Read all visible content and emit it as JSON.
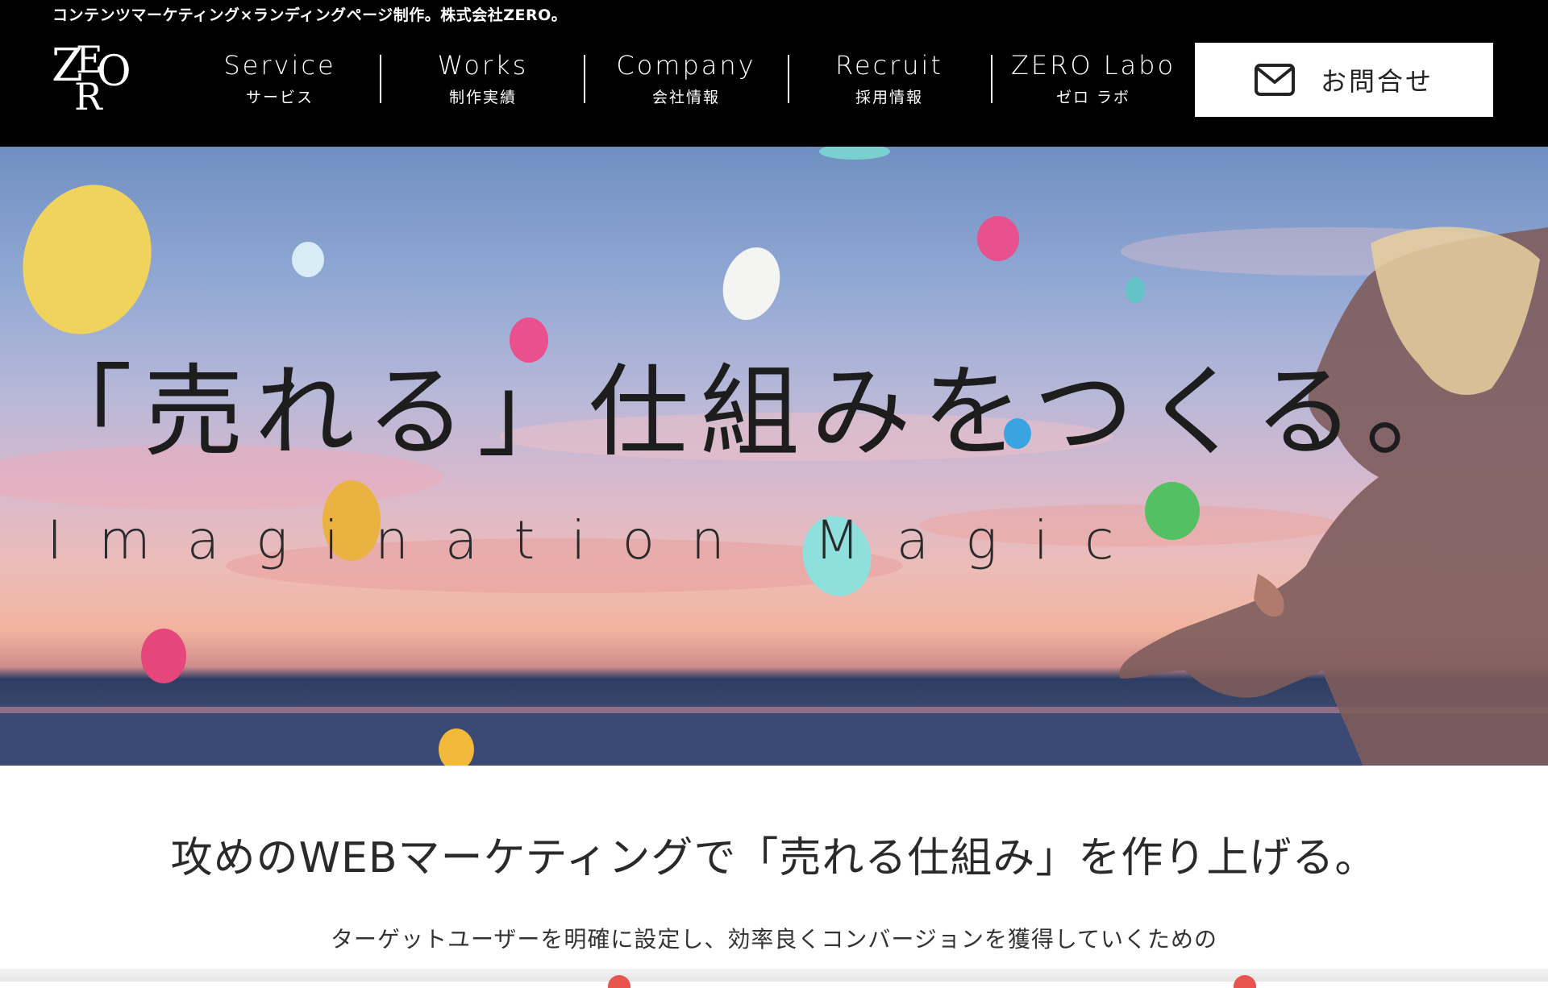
{
  "header": {
    "tagline": "コンテンツマーケティング×ランディングページ制作。株式会社ZERO。",
    "logo_letters": "ZERO",
    "nav": [
      {
        "en": "Service",
        "jp": "サービス"
      },
      {
        "en": "Works",
        "jp": "制作実績"
      },
      {
        "en": "Company",
        "jp": "会社情報"
      },
      {
        "en": "Recruit",
        "jp": "採用情報"
      },
      {
        "en": "ZERO Labo",
        "jp": "ゼロ ラボ"
      }
    ],
    "contact": {
      "label": "お問合せ",
      "icon": "mail-icon"
    }
  },
  "hero": {
    "title": "「売れる」仕組みをつくる。",
    "subtitle": "Imagination Magic"
  },
  "content": {
    "lead": "攻めのWEBマーケティングで「売れる仕組み」を作り上げる。",
    "description": "ターゲットユーザーを明確に設定し、効率良くコンバージョンを獲得していくための"
  },
  "colors": {
    "header_bg": "#000000",
    "header_text": "#ffffff",
    "body_text": "#2a2a2a"
  }
}
